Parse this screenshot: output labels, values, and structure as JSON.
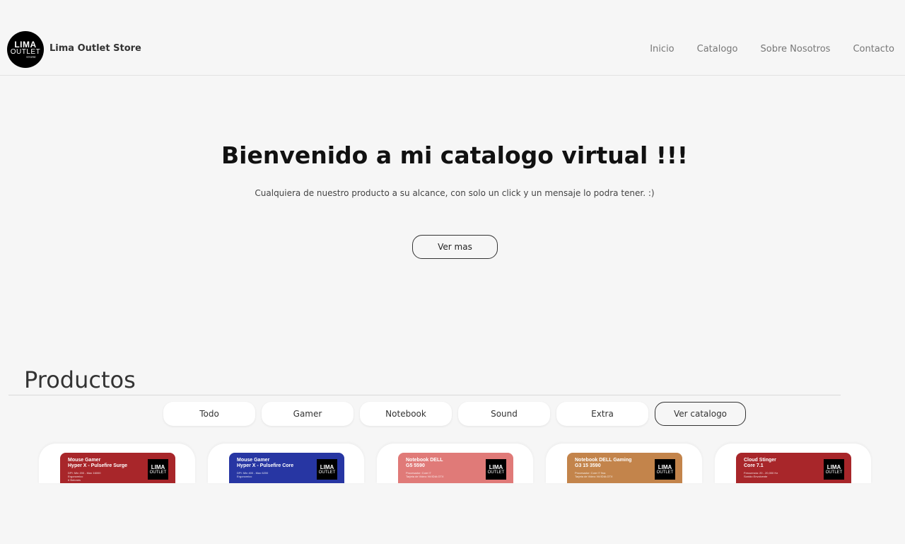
{
  "header": {
    "logo": {
      "line1": "LIMA",
      "line2": "OUTLET",
      "line3": "STORE"
    },
    "brand": "Lima Outlet Store",
    "nav": [
      "Inicio",
      "Catalogo",
      "Sobre Nosotros",
      "Contacto"
    ]
  },
  "hero": {
    "title": "Bienvenido a mi catalogo virtual !!!",
    "subtitle": "Cualquiera de nuestro producto a su alcance, con solo un click y un mensaje lo podra tener. :)",
    "button": "Ver mas"
  },
  "products": {
    "title": "Productos",
    "filters": [
      "Todo",
      "Gamer",
      "Notebook",
      "Sound",
      "Extra"
    ],
    "catalog_button": "Ver catalogo",
    "cards": [
      {
        "title": "Mouse Gamer\nHyper X - Pulsefire Surge",
        "desc": "DPI: Min 200 - Max 16000\nErgonomico\n6 Botones",
        "color": "#a8262a"
      },
      {
        "title": "Mouse Gamer\nHyper X - Pulsefire Core",
        "desc": "DPI: Min 400 - Max 6200\nErgonomico",
        "color": "#2736a3"
      },
      {
        "title": "Notebook DELL\nG5 5590",
        "desc": "Procesador: Core i7\nTarjeta de Video: NVIDIA GTX",
        "color": "#e07a78"
      },
      {
        "title": "Notebook DELL Gaming\nG3 15 3590",
        "desc": "Procesador: Core i7 9na\nTarjeta de Video: NVIDIA GTX",
        "color": "#c3844b"
      },
      {
        "title": "Cloud Stinger\nCore 7.1",
        "desc": "Frecuencia: 20 - 20,000 Hz\nSonido Envolvente",
        "color": "#a8262a"
      }
    ],
    "card_logo": {
      "line1": "LIMA",
      "line2": "OUTLET"
    }
  }
}
